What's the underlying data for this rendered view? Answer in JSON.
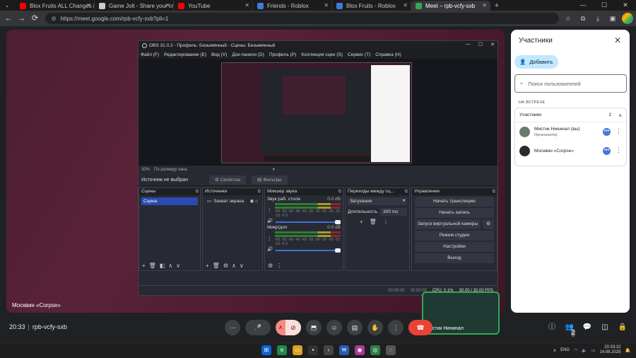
{
  "browser": {
    "tabs": [
      {
        "title": "Blox Fruits ALL Changes in Upda",
        "color": "#ff0000",
        "active": false
      },
      {
        "title": "Game Jolt - Share your creations",
        "color": "#cccccc",
        "active": false
      },
      {
        "title": "YouTube",
        "color": "#ff0000",
        "active": false
      },
      {
        "title": "Friends - Roblox",
        "color": "#3f7bd9",
        "active": false
      },
      {
        "title": "Blox Fruits - Roblox",
        "color": "#3f7bd9",
        "active": false
      },
      {
        "title": "Meet – rpb-vcfy-sxb",
        "color": "#34a853",
        "active": true
      }
    ],
    "url": "https://meet.google.com/rpb-vcfy-sxb?pli=1"
  },
  "stage": {
    "presenter_name": "Москвин «Corpse»",
    "self_name": "Мистик Нининал"
  },
  "obs": {
    "title": "OBS 31.0.2 - Профиль: Безымянный - Сцены: Безымянный",
    "menu": [
      "Файл (F)",
      "Редактирование (E)",
      "Вид (V)",
      "Док-панели (D)",
      "Профиль (P)",
      "Коллекция сцен (S)",
      "Сервис (T)",
      "Справка (H)"
    ],
    "zoom": "30%",
    "zoom_mode": "По размеру окна",
    "no_source": "Источник не выбран",
    "properties": "Свойства",
    "filters": "Фильтры",
    "docks": {
      "scenes": {
        "title": "Сцены",
        "item": "Сцена"
      },
      "sources": {
        "title": "Источники",
        "item": "Захват экрана"
      },
      "mixer": {
        "title": "Микшер звука",
        "channels": [
          {
            "name": "Звук раб. стола",
            "db": "0.0 dB"
          },
          {
            "name": "Микр/доп",
            "db": "0.0 dB"
          }
        ],
        "ticks": "-60 -55 -50 -45 -40 -35 -30 -25 -20 -15 -10 -5 0"
      },
      "transitions": {
        "title": "Переходы между сц...",
        "type": "Затухание",
        "duration_label": "Длительность",
        "duration": "300 ms"
      },
      "controls": {
        "title": "Управление",
        "buttons": [
          "Начать трансляцию",
          "Начать запись",
          "Запуск виртуальной камеры",
          "Режим студии",
          "Настройки",
          "Выход"
        ]
      }
    },
    "status": {
      "t1": "00:00:00",
      "t2": "00:00:00",
      "cpu": "CPU: 0.1%",
      "fps": "30.00 / 30.00 FPS"
    }
  },
  "panel": {
    "title": "Участники",
    "add": "Добавить",
    "search_placeholder": "Поиск пользователей",
    "in_call": "НА ВСТРЕЧЕ",
    "group_label": "Участники",
    "group_count": "2",
    "people": [
      {
        "name": "Мистик Нининал (вы)",
        "role": "Организатор",
        "avatar": "#6b7b6e"
      },
      {
        "name": "Москвин «Corpse»",
        "role": "",
        "avatar": "#2b2b2b"
      }
    ]
  },
  "bottom": {
    "time": "20:33",
    "code": "rpb-vcfy-sxb",
    "participants_badge": "2"
  },
  "taskbar": {
    "lang": "ENG",
    "time": "20:33:10",
    "date": "14.08.2025"
  }
}
